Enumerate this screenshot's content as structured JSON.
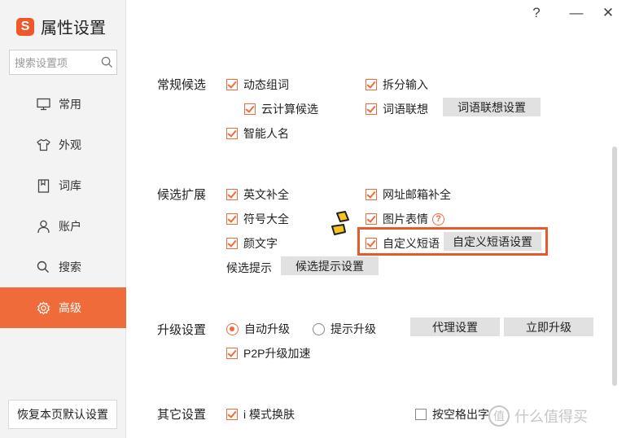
{
  "app": {
    "title": "属性设置",
    "logo_glyph": "S",
    "accent": "#f06b3a"
  },
  "window_controls": {
    "help": "?",
    "minimize": "—",
    "close": "✕"
  },
  "search": {
    "placeholder": "搜索设置项"
  },
  "nav": {
    "items": [
      {
        "label": "常用",
        "icon": "monitor-icon"
      },
      {
        "label": "外观",
        "icon": "shirt-icon"
      },
      {
        "label": "词库",
        "icon": "book-icon"
      },
      {
        "label": "账户",
        "icon": "user-icon"
      },
      {
        "label": "搜索",
        "icon": "search-icon"
      },
      {
        "label": "高级",
        "icon": "gear-icon",
        "active": true
      }
    ]
  },
  "reset_button": "恢复本页默认设置",
  "sections": {
    "regular": {
      "title": "常规候选",
      "dynamic_phrase": "动态组词",
      "split_input": "拆分输入",
      "cloud_candidate": "云计算候选",
      "word_association": "词语联想",
      "word_association_btn": "词语联想设置",
      "smart_name": "智能人名"
    },
    "expand": {
      "title": "候选扩展",
      "english_completion": "英文补全",
      "url_email": "网址邮箱补全",
      "symbols": "符号大全",
      "emoji": "图片表情",
      "kaomoji": "颜文字",
      "custom_phrase": "自定义短语",
      "custom_phrase_btn": "自定义短语设置",
      "candidate_tip": "候选提示",
      "candidate_tip_btn": "候选提示设置"
    },
    "upgrade": {
      "title": "升级设置",
      "auto_upgrade": "自动升级",
      "prompt_upgrade": "提示升级",
      "proxy_btn": "代理设置",
      "upgrade_now_btn": "立即升级",
      "p2p": "P2P升级加速"
    },
    "other": {
      "title": "其它设置",
      "i_mode": "i 模式换肤",
      "space_out": "按空格出字"
    }
  },
  "watermark": {
    "glyph": "值",
    "text": "什么值得买"
  }
}
